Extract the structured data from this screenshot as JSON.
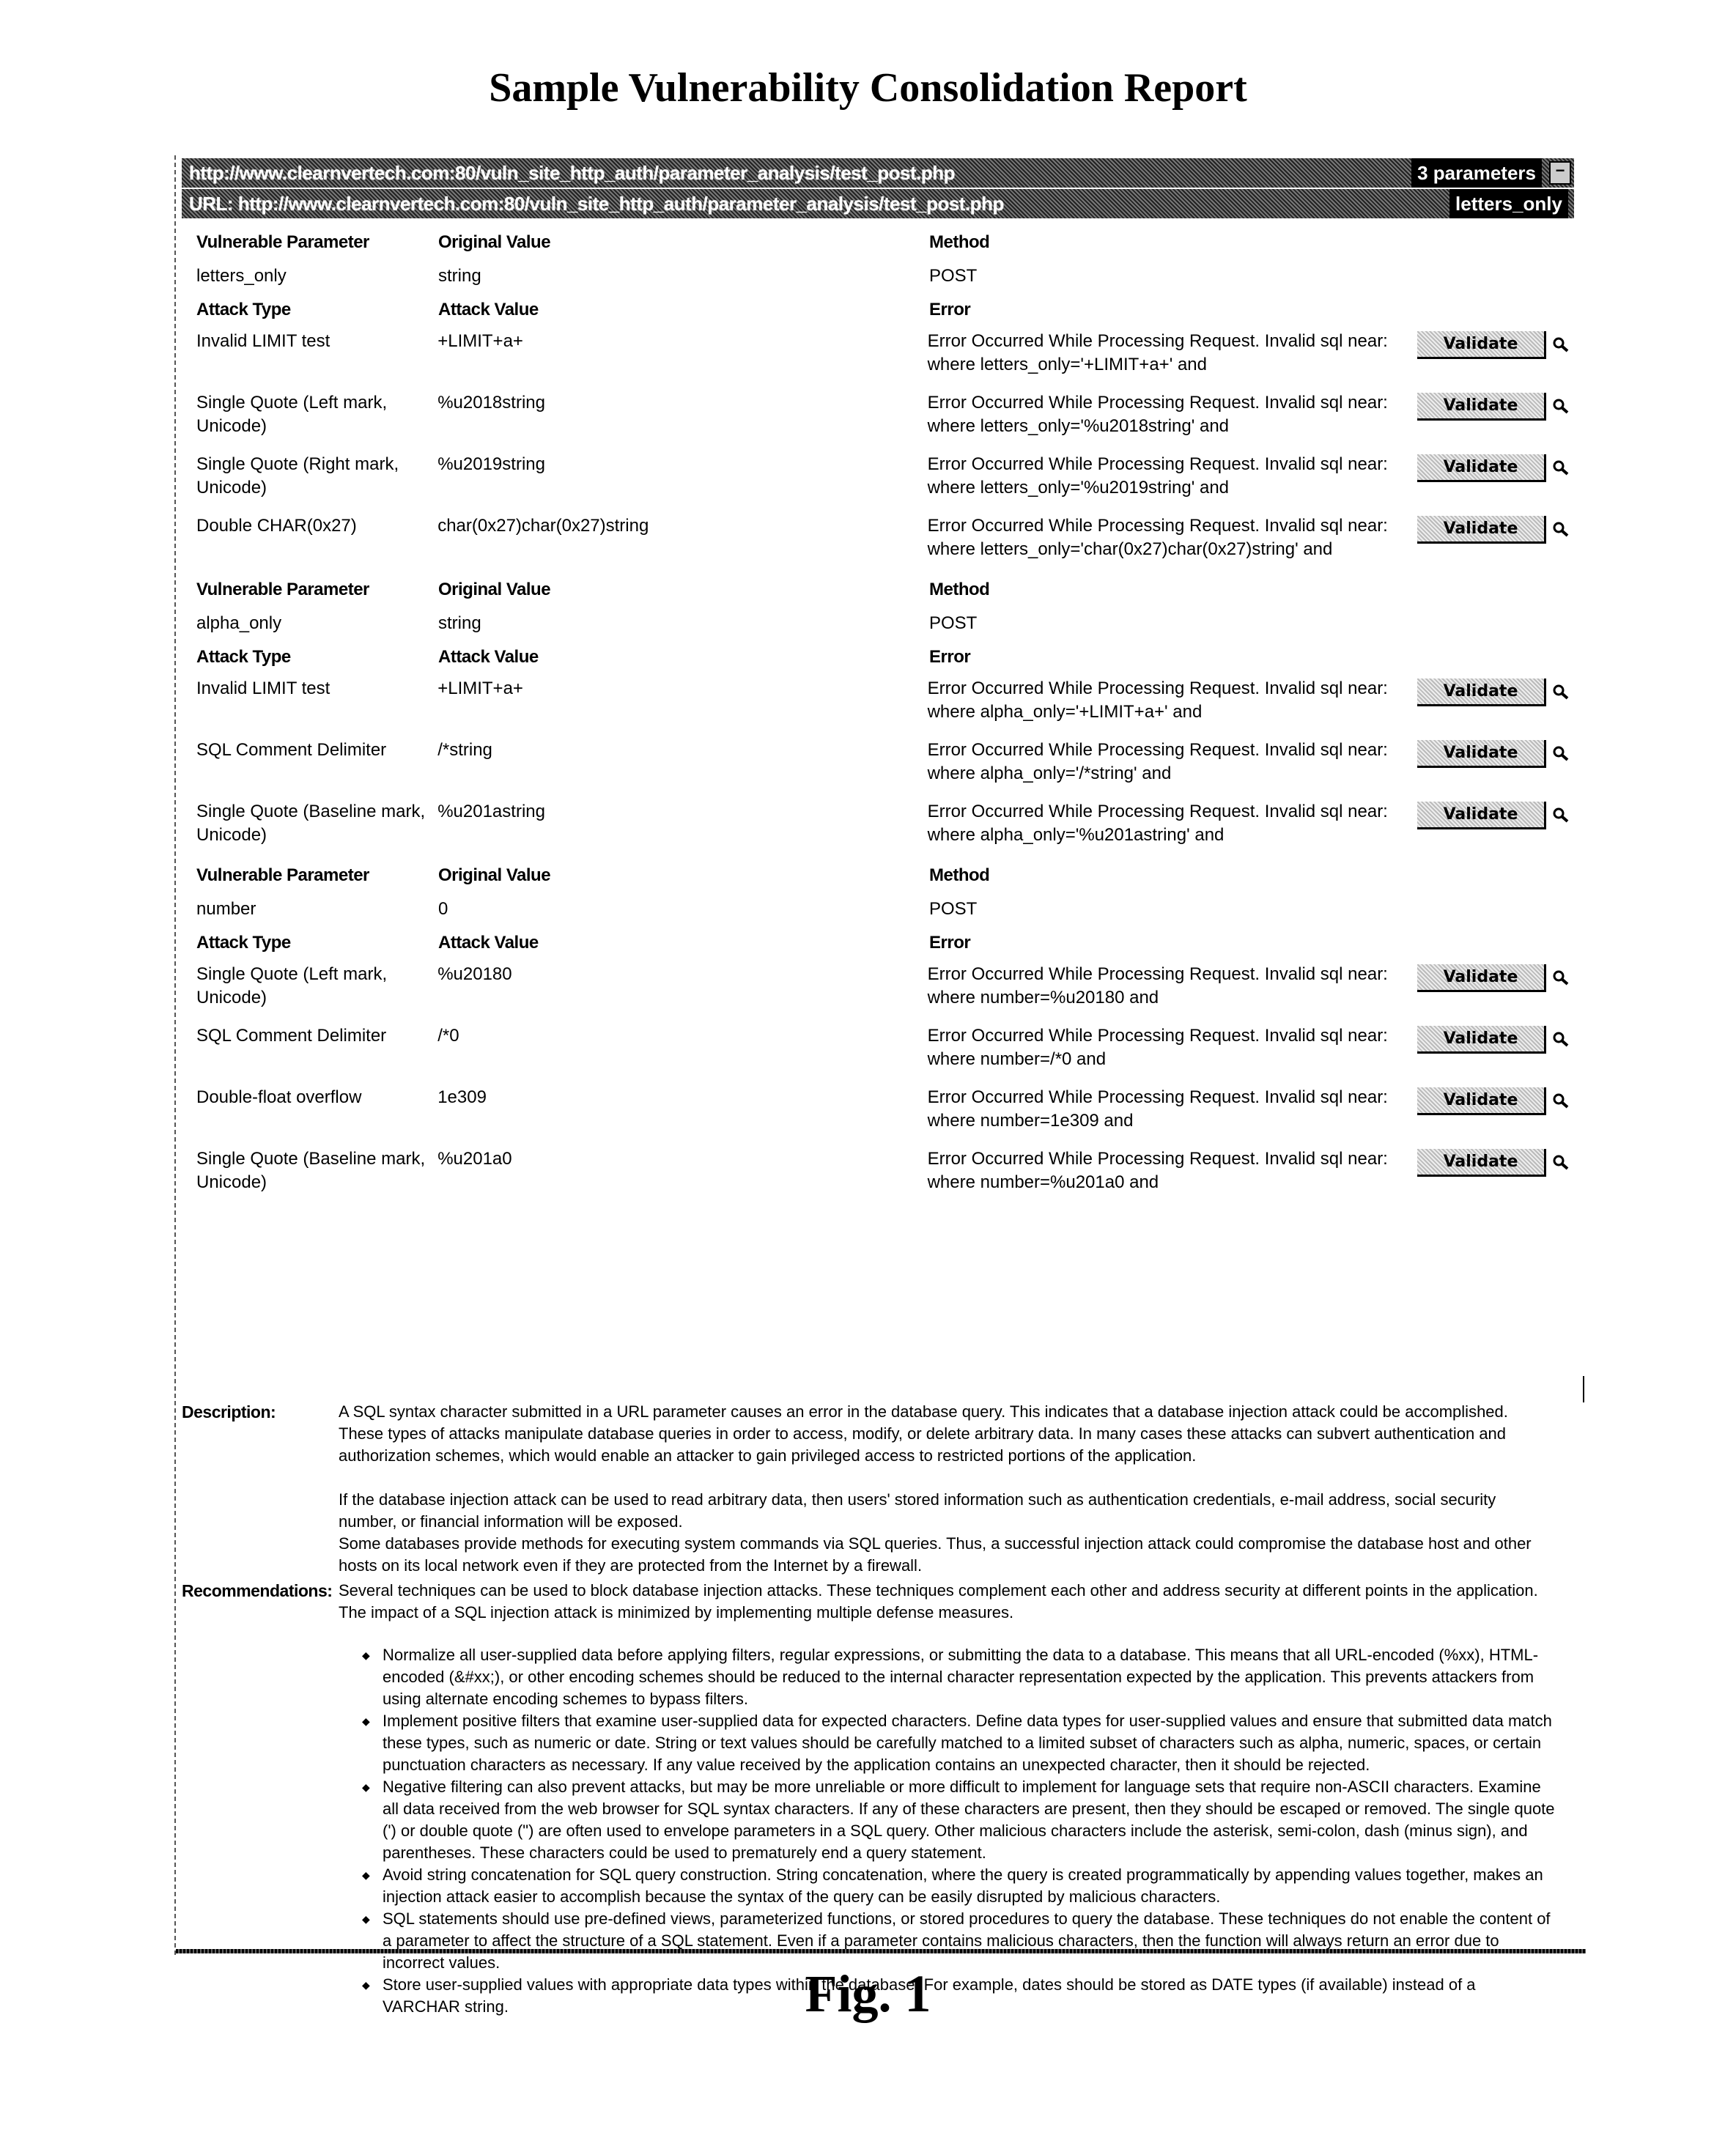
{
  "title": "Sample Vulnerability Consolidation Report",
  "header": {
    "path_url": "http://www.clearnvertech.com:80/vuln_site_http_auth/parameter_analysis/test_post.php",
    "path_count": "3 parameters",
    "url_label": "URL: http://www.clearnvertech.com:80/vuln_site_http_auth/parameter_analysis/test_post.php",
    "url_param": "letters_only",
    "collapse_symbol": "−"
  },
  "labels": {
    "vulnerable_parameter": "Vulnerable Parameter",
    "original_value": "Original Value",
    "method": "Method",
    "attack_type": "Attack Type",
    "attack_value": "Attack Value",
    "error": "Error",
    "validate": "Validate"
  },
  "groups": [
    {
      "parameter": "letters_only",
      "original_value": "string",
      "method": "POST",
      "attacks": [
        {
          "type": "Invalid LIMIT test",
          "value": "+LIMIT+a+",
          "error": "Error Occurred While Processing Request. Invalid sql near: where letters_only='+LIMIT+a+' and"
        },
        {
          "type": "Single Quote (Left mark, Unicode)",
          "value": "%u2018string",
          "error": "Error Occurred While Processing Request. Invalid sql near: where letters_only='%u2018string' and"
        },
        {
          "type": "Single Quote (Right mark, Unicode)",
          "value": "%u2019string",
          "error": "Error Occurred While Processing Request. Invalid sql near: where letters_only='%u2019string' and"
        },
        {
          "type": "Double CHAR(0x27)",
          "value": "char(0x27)char(0x27)string",
          "error": "Error Occurred While Processing Request. Invalid sql near: where letters_only='char(0x27)char(0x27)string' and"
        }
      ]
    },
    {
      "parameter": "alpha_only",
      "original_value": "string",
      "method": "POST",
      "attacks": [
        {
          "type": "Invalid LIMIT test",
          "value": "+LIMIT+a+",
          "error": "Error Occurred While Processing Request. Invalid sql near: where alpha_only='+LIMIT+a+' and"
        },
        {
          "type": "SQL Comment Delimiter",
          "value": "/*string",
          "error": "Error Occurred While Processing Request. Invalid sql near: where alpha_only='/*string' and"
        },
        {
          "type": "Single Quote (Baseline mark, Unicode)",
          "value": "%u201astring",
          "error": "Error Occurred While Processing Request. Invalid sql near: where alpha_only='%u201astring' and"
        }
      ]
    },
    {
      "parameter": "number",
      "original_value": "0",
      "method": "POST",
      "attacks": [
        {
          "type": "Single Quote (Left mark, Unicode)",
          "value": "%u20180",
          "error": "Error Occurred While Processing Request. Invalid sql near: where number=%u20180 and"
        },
        {
          "type": "SQL Comment Delimiter",
          "value": "/*0",
          "error": "Error Occurred While Processing Request. Invalid sql near: where number=/*0 and"
        },
        {
          "type": "Double-float overflow",
          "value": "1e309",
          "error": "Error Occurred While Processing Request. Invalid sql near: where number=1e309 and"
        },
        {
          "type": "Single Quote (Baseline mark, Unicode)",
          "value": "%u201a0",
          "error": "Error Occurred While Processing Request. Invalid sql near: where number=%u201a0 and"
        }
      ]
    }
  ],
  "description": {
    "label": "Description:",
    "paragraphs": [
      "A SQL syntax character submitted in a URL parameter causes an error in the database query. This indicates that a database injection attack could be accomplished. These types of attacks manipulate database queries in order to access, modify, or delete arbitrary data. In many cases these attacks can subvert authentication and authorization schemes, which would enable an attacker to gain privileged access to restricted portions of the application.",
      "If the database injection attack can be used to read arbitrary data, then users' stored information such as authentication credentials, e-mail address, social security number, or financial information will be exposed.",
      "Some databases provide methods for executing system commands via SQL queries. Thus, a successful injection attack could compromise the database host and other hosts on its local network even if they are protected from the Internet by a firewall."
    ]
  },
  "recommendations": {
    "label": "Recommendations:",
    "intro": "Several techniques can be used to block database injection attacks. These techniques complement each other and address security at different points in the application. The impact of a SQL injection attack is minimized by implementing multiple defense measures.",
    "items": [
      "Normalize all user-supplied data before applying filters, regular expressions, or submitting the data to a database. This means that all URL-encoded (%xx), HTML-encoded (&#xx;), or other encoding schemes should be reduced to the internal character representation expected by the application. This prevents attackers from using alternate encoding schemes to bypass filters.",
      "Implement positive filters that examine user-supplied data for expected characters. Define data types for user-supplied values and ensure that submitted data match these types, such as numeric or date. String or text values should be carefully matched to a limited subset of characters such as alpha, numeric, spaces, or certain punctuation characters as necessary. If any value received by the application contains an unexpected character, then it should be rejected.",
      "Negative filtering can also prevent attacks, but may be more unreliable or more difficult to implement for language sets that require non-ASCII characters. Examine all data received from the web browser for SQL syntax characters. If any of these characters are present, then they should be escaped or removed. The single quote (') or double quote (\") are often used to envelope parameters in a SQL query. Other malicious characters include the asterisk, semi-colon, dash (minus sign), and parentheses. These characters could be used to prematurely end a query statement.",
      "Avoid string concatenation for SQL query construction. String concatenation, where the query is created programmatically by appending values together, makes an injection attack easier to accomplish because the syntax of the query can be easily disrupted by malicious characters.",
      "SQL statements should use pre-defined views, parameterized functions, or stored procedures to query the database. These techniques do not enable the content of a parameter to affect the structure of a SQL statement. Even if a parameter contains malicious characters, then the function will always return an error due to incorrect values.",
      "Store user-supplied values with appropriate data types within the database. For example, dates should be stored as DATE types (if available) instead of a VARCHAR string."
    ]
  },
  "figure_label": "Fig. 1"
}
